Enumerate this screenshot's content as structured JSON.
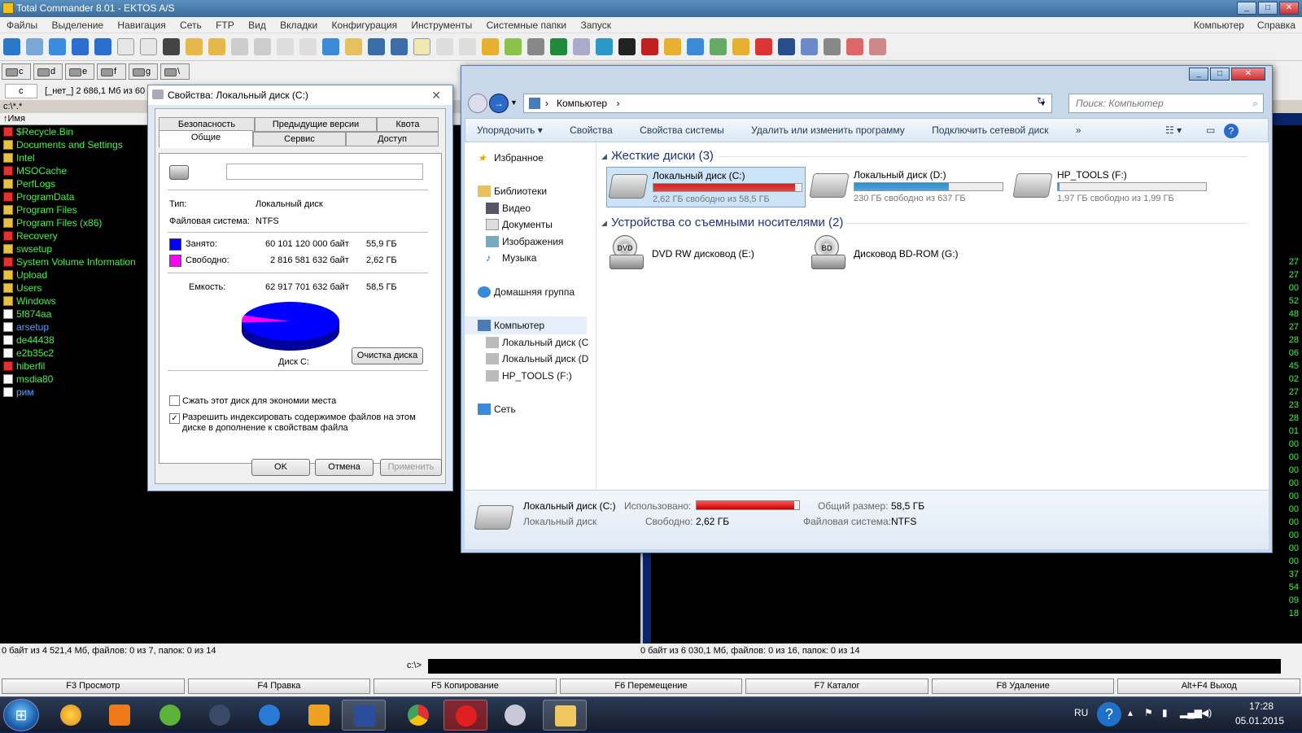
{
  "tc": {
    "title": "Total Commander 8.01 - EKTOS A/S",
    "menu": [
      "Файлы",
      "Выделение",
      "Навигация",
      "Сеть",
      "FTP",
      "Вид",
      "Вкладки",
      "Конфигурация",
      "Инструменты",
      "Системные папки",
      "Запуск"
    ],
    "menu_right": [
      "Компьютер",
      "Справка"
    ],
    "drives": [
      "c",
      "d",
      "e",
      "f",
      "g",
      "\\"
    ],
    "drive_combo": "c",
    "drive_info": "[_нет_]  2 686,1 Мб из 60",
    "current_path": "c:\\*.*",
    "col_name": "Имя",
    "left_files": [
      {
        "name": "$Recycle.Bin",
        "kind": "sys"
      },
      {
        "name": "Documents and Settings",
        "kind": "dir"
      },
      {
        "name": "Intel",
        "kind": "dir"
      },
      {
        "name": "MSOCache",
        "kind": "sys"
      },
      {
        "name": "PerfLogs",
        "kind": "dir"
      },
      {
        "name": "ProgramData",
        "kind": "sys"
      },
      {
        "name": "Program Files",
        "kind": "dir"
      },
      {
        "name": "Program Files (x86)",
        "kind": "dir"
      },
      {
        "name": "Recovery",
        "kind": "sys"
      },
      {
        "name": "swsetup",
        "kind": "dir"
      },
      {
        "name": "System Volume Information",
        "kind": "sys"
      },
      {
        "name": "Upload",
        "kind": "dir"
      },
      {
        "name": "Users",
        "kind": "dir"
      },
      {
        "name": "Windows",
        "kind": "dir"
      },
      {
        "name": "5f874aa",
        "kind": "file"
      },
      {
        "name": "arsetup",
        "kind": "file-blue"
      },
      {
        "name": "de44438",
        "kind": "file"
      },
      {
        "name": "e2b35c2",
        "kind": "file"
      },
      {
        "name": "hiberfil",
        "kind": "sys"
      },
      {
        "name": "msdia80",
        "kind": "file"
      },
      {
        "name": "рим",
        "kind": "file-blue"
      }
    ],
    "right_times": [
      "27",
      "27",
      "00",
      "52",
      "48",
      "27",
      "28",
      "06",
      "45",
      "02",
      "27",
      "23",
      "28",
      "01",
      "00",
      "00",
      "00",
      "00",
      "00",
      "00",
      "00",
      "00",
      "00",
      "00",
      "37",
      "54",
      "09",
      "18"
    ],
    "status_left": "0 байт из 4 521,4 Мб, файлов: 0 из 7, папок: 0 из 14",
    "status_right": "0 байт из 6 030,1 Мб, файлов: 0 из 16, папок: 0 из 14",
    "cmd_prompt": "c:\\>",
    "fkeys": [
      "F3 Просмотр",
      "F4 Правка",
      "F5 Копирование",
      "F6 Перемещение",
      "F7 Каталог",
      "F8 Удаление",
      "Alt+F4 Выход"
    ]
  },
  "props": {
    "title": "Свойства: Локальный диск (C:)",
    "tabs_row1": [
      "Безопасность",
      "Предыдущие версии",
      "Квота"
    ],
    "tabs_row2": [
      "Общие",
      "Сервис",
      "Доступ"
    ],
    "label_value": "",
    "type_label": "Тип:",
    "type_value": "Локальный диск",
    "fs_label": "Файловая система:",
    "fs_value": "NTFS",
    "used_label": "Занято:",
    "used_bytes": "60 101 120 000 байт",
    "used_gb": "55,9 ГБ",
    "free_label": "Свободно:",
    "free_bytes": "2 816 581 632 байт",
    "free_gb": "2,62 ГБ",
    "cap_label": "Емкость:",
    "cap_bytes": "62 917 701 632 байт",
    "cap_gb": "58,5 ГБ",
    "disk_label": "Диск C:",
    "cleanup_btn": "Очистка диска",
    "compress_label": "Сжать этот диск для экономии места",
    "index_label1": "Разрешить индексировать содержимое файлов на этом",
    "index_label2": "диске в дополнение к свойствам файла",
    "ok": "OK",
    "cancel": "Отмена",
    "apply": "Применить",
    "used_color": "#0000ff",
    "free_color": "#ff00ff",
    "used_fraction": 0.955
  },
  "explorer": {
    "address": "Компьютер",
    "search_placeholder": "Поиск: Компьютер",
    "commands": [
      "Упорядочить ▾",
      "Свойства",
      "Свойства системы",
      "Удалить или изменить программу",
      "Подключить сетевой диск",
      "»"
    ],
    "nav": {
      "favorites": "Избранное",
      "libraries": "Библиотеки",
      "lib_items": [
        "Видео",
        "Документы",
        "Изображения",
        "Музыка"
      ],
      "homegroup": "Домашняя группа",
      "computer": "Компьютер",
      "comp_items": [
        "Локальный диск (C",
        "Локальный диск (D",
        "HP_TOOLS (F:)"
      ],
      "network": "Сеть"
    },
    "hdd_group": "Жесткие диски (3)",
    "removable_group": "Устройства со съемными носителями (2)",
    "drives": [
      {
        "name": "Локальный диск (C:)",
        "free": "2,62 ГБ свободно из 58,5 ГБ",
        "fill": 0.955,
        "color": "#d42020"
      },
      {
        "name": "Локальный диск (D:)",
        "free": "230 ГБ свободно из 637 ГБ",
        "fill": 0.64,
        "color": "#2a8fd0"
      },
      {
        "name": "HP_TOOLS (F:)",
        "free": "1,97 ГБ свободно из 1,99 ГБ",
        "fill": 0.01,
        "color": "#2a8fd0"
      }
    ],
    "removable": [
      {
        "name": "DVD RW дисковод (E:)",
        "icon": "DVD"
      },
      {
        "name": "Дисковод BD-ROM (G:)",
        "icon": "BD"
      }
    ],
    "details": {
      "name": "Локальный диск (C:)",
      "type": "Локальный диск",
      "used_label": "Использовано:",
      "free_label": "Свободно:",
      "free_value": "2,62 ГБ",
      "total_label": "Общий размер:",
      "total_value": "58,5 ГБ",
      "fs_label": "Файловая система:",
      "fs_value": "NTFS",
      "used_fill": 0.955
    }
  },
  "taskbar": {
    "lang": "RU",
    "time": "17:28",
    "date": "05.01.2015"
  }
}
